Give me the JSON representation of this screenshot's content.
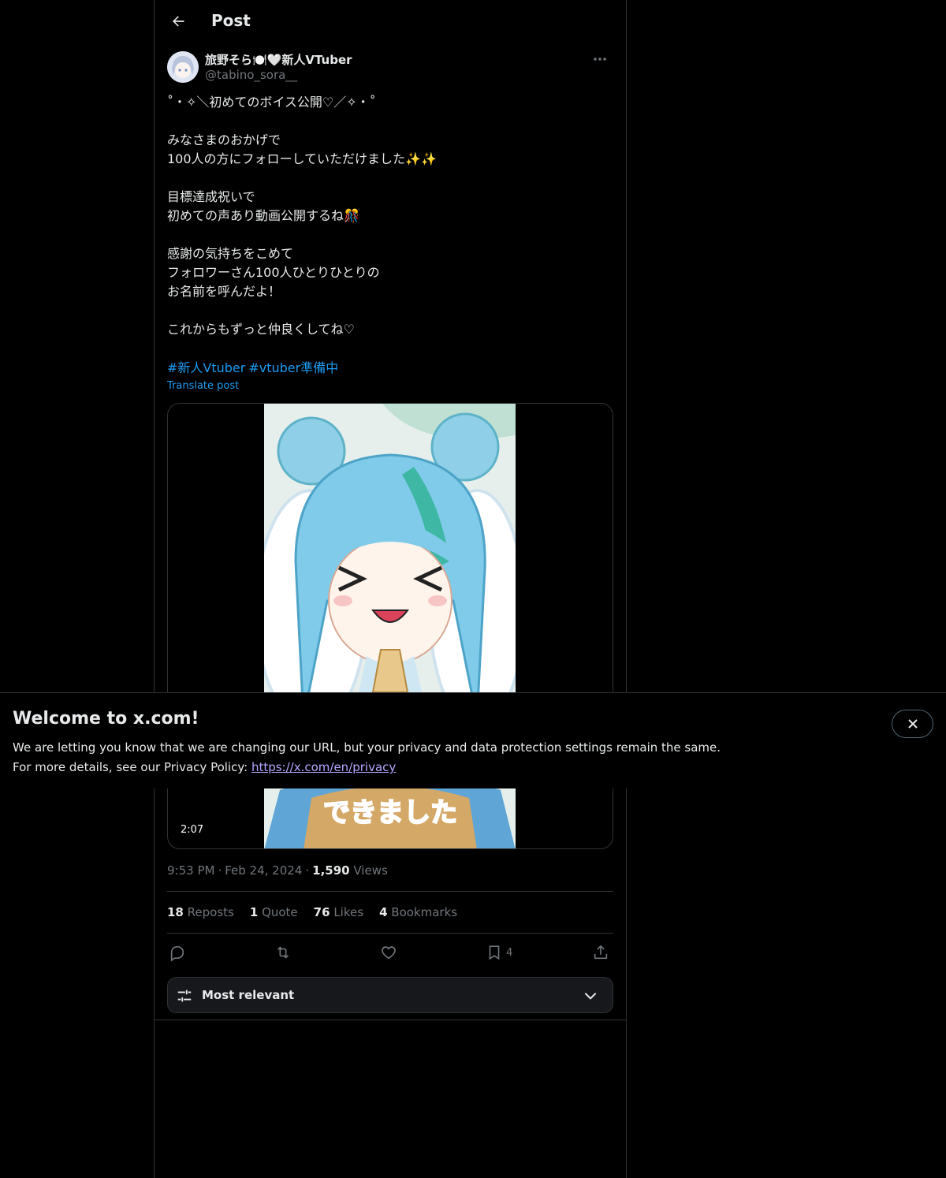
{
  "header": {
    "title": "Post"
  },
  "author": {
    "display_name": "旅野そら🍽️🤍新人VTuber",
    "handle": "@tabino_sora__"
  },
  "post": {
    "lines": [
      "˚・✧＼初めてのボイス公開♡／✧・˚",
      "",
      "みなさまのおかげで",
      "100人の方にフォローしていただけました✨✨",
      "",
      "目標達成祝いで",
      "初めての声あり動画公開するね🎊",
      "",
      "感謝の気持ちをこめて",
      "フォロワーさん100人ひとりひとりの",
      "お名前を呼んだよ！",
      "",
      "これからもずっと仲良くしてね♡"
    ],
    "hashtags": [
      "#新人Vtuber",
      "#vtuber準備中"
    ],
    "translate_label": "Translate post"
  },
  "media": {
    "caption_text": "できました",
    "duration": "2:07"
  },
  "meta": {
    "time": "9:53 PM",
    "date": "Feb 24, 2024",
    "views_count": "1,590",
    "views_label": "Views"
  },
  "stats": {
    "reposts_count": "18",
    "reposts_label": "Reposts",
    "quotes_count": "1",
    "quotes_label": "Quote",
    "likes_count": "76",
    "likes_label": "Likes",
    "bookmarks_count": "4",
    "bookmarks_label": "Bookmarks"
  },
  "actions": {
    "bookmark_count": "4"
  },
  "sort": {
    "label": "Most relevant"
  },
  "banner": {
    "title": "Welcome to x.com!",
    "line1": "We are letting you know that we are changing our URL, but your privacy and data protection settings remain the same.",
    "line2_prefix": "For more details, see our Privacy Policy: ",
    "link": "https://x.com/en/privacy"
  },
  "colors": {
    "accent": "#1d9bf0",
    "background": "#000000",
    "muted": "#71767b",
    "border": "#2f3336"
  },
  "icons": [
    "back-arrow-icon",
    "more-icon",
    "reply-icon",
    "repost-icon",
    "like-icon",
    "bookmark-icon",
    "share-icon",
    "sliders-icon",
    "chevron-down-icon",
    "close-icon"
  ]
}
